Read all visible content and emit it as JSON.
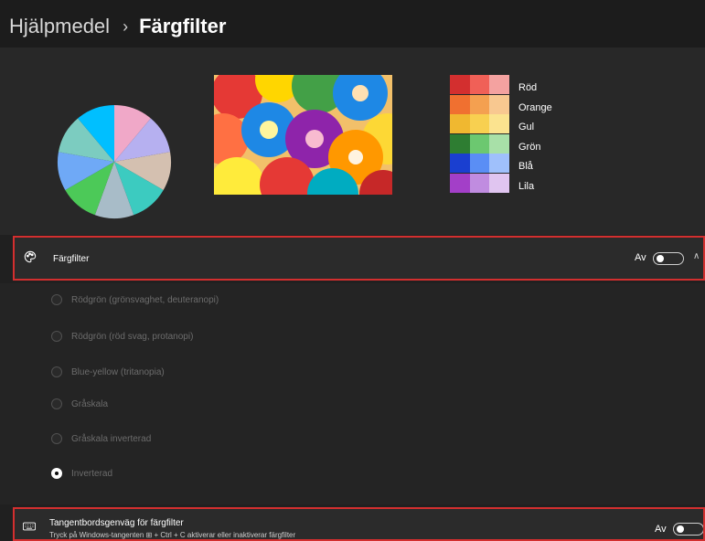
{
  "header": {
    "parent": "Hjälpmedel",
    "separator": "›",
    "title": "Färgfilter"
  },
  "preview": {
    "pie_colors": [
      "#f0a8c8",
      "#b6b0f0",
      "#d4c0b0",
      "#3ccbc0",
      "#a8bcc8",
      "#4cc958",
      "#6fa9f6",
      "#7cccc0",
      "#00bfff"
    ],
    "photo_colors": [
      "#e91e63",
      "#ff9800",
      "#ffeb3b",
      "#4caf50",
      "#2196f3",
      "#f44336",
      "#9c27b0",
      "#00bcd4"
    ],
    "swatches": [
      {
        "label": "Röd",
        "colors": [
          "#d32f2f",
          "#f06057",
          "#f4a2a0"
        ]
      },
      {
        "label": "Orange",
        "colors": [
          "#f07030",
          "#f4a050",
          "#f8c890"
        ]
      },
      {
        "label": "Gul",
        "colors": [
          "#f0b830",
          "#f8d050",
          "#fbe38f"
        ]
      },
      {
        "label": "Grön",
        "colors": [
          "#2e7d32",
          "#6cc870",
          "#a8e0a8"
        ]
      },
      {
        "label": "Blå",
        "colors": [
          "#1a3fd0",
          "#5a8ef5",
          "#9fc0fb"
        ]
      },
      {
        "label": "Lila",
        "colors": [
          "#a33fc8",
          "#c08ce0",
          "#e0c5f0"
        ]
      }
    ]
  },
  "color_filter": {
    "title": "Färgfilter",
    "state": "Av"
  },
  "filter_options": [
    {
      "label": "Rödgrön (grönsvaghet, deuteranopi)",
      "selected": false
    },
    {
      "label": "Rödgrön (röd svag, protanopi)",
      "selected": false
    },
    {
      "label": "Blue-yellow (tritanopia)",
      "selected": false
    },
    {
      "label": "Gråskala",
      "selected": false
    },
    {
      "label": "Gråskala inverterad",
      "selected": false
    },
    {
      "label": "Inverterad",
      "selected": true
    }
  ],
  "shortcut": {
    "title": "Tangentbordsgenväg för färgfilter",
    "subtitle": "Tryck på Windows-tangenten ⊞ + Ctrl + C aktiverar eller inaktiverar färgfilter",
    "state": "Av"
  }
}
